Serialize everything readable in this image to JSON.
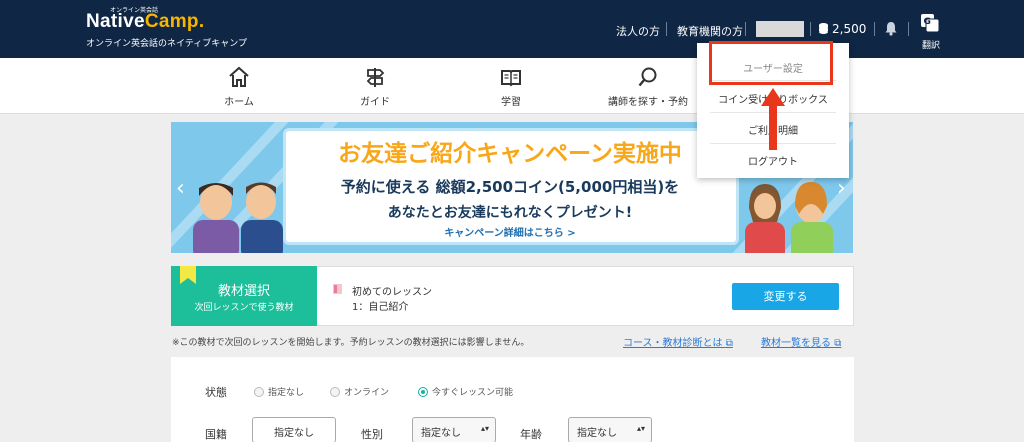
{
  "header": {
    "logo_tag": "オンライン英会話",
    "logo_main": "Native",
    "logo_accent": "Camp.",
    "logo_sub": "オンライン英会話のネイティブキャンプ",
    "link_corporate": "法人の方",
    "link_education": "教育機関の方",
    "coins": "2,500",
    "translate_label": "翻訳"
  },
  "nav": {
    "items": [
      {
        "label": "ホーム",
        "icon": "home-icon"
      },
      {
        "label": "ガイド",
        "icon": "signpost-icon"
      },
      {
        "label": "学習",
        "icon": "book-icon"
      },
      {
        "label": "講師を探す・予約",
        "icon": "search-icon"
      }
    ]
  },
  "dropdown": {
    "items": [
      "ユーザー設定",
      "コイン受け取りボックス",
      "ご利用明細",
      "ログアウト"
    ]
  },
  "banner": {
    "title": "お友達ご紹介キャンペーン実施中",
    "line1": "予約に使える 総額2,500コイン(5,000円相当)を",
    "line2": "あなたとお友達にもれなくプレゼント!",
    "line3": "キャンペーン詳細はこちら >"
  },
  "material": {
    "title": "教材選択",
    "subtitle": "次回レッスンで使う教材",
    "line1": "初めてのレッスン",
    "line2": "1：自己紹介",
    "change_button": "変更する"
  },
  "note": {
    "text": "※この教材で次回のレッスンを開始します。予約レッスンの教材選択には影響しません。",
    "link1": "コース・教材診断とは",
    "link2": "教材一覧を見る"
  },
  "filter": {
    "status_label": "状態",
    "status_options": [
      "指定なし",
      "オンライン",
      "今すぐレッスン可能"
    ],
    "nationality_label": "国籍",
    "nationality_value": "指定なし",
    "gender_label": "性別",
    "gender_value": "指定なし",
    "age_label": "年齢",
    "age_value": "指定なし"
  },
  "colors": {
    "header_bg": "#0f2645",
    "accent_green": "#1dbf9a",
    "button_blue": "#19a6e6",
    "highlight_red": "#e8371b"
  }
}
